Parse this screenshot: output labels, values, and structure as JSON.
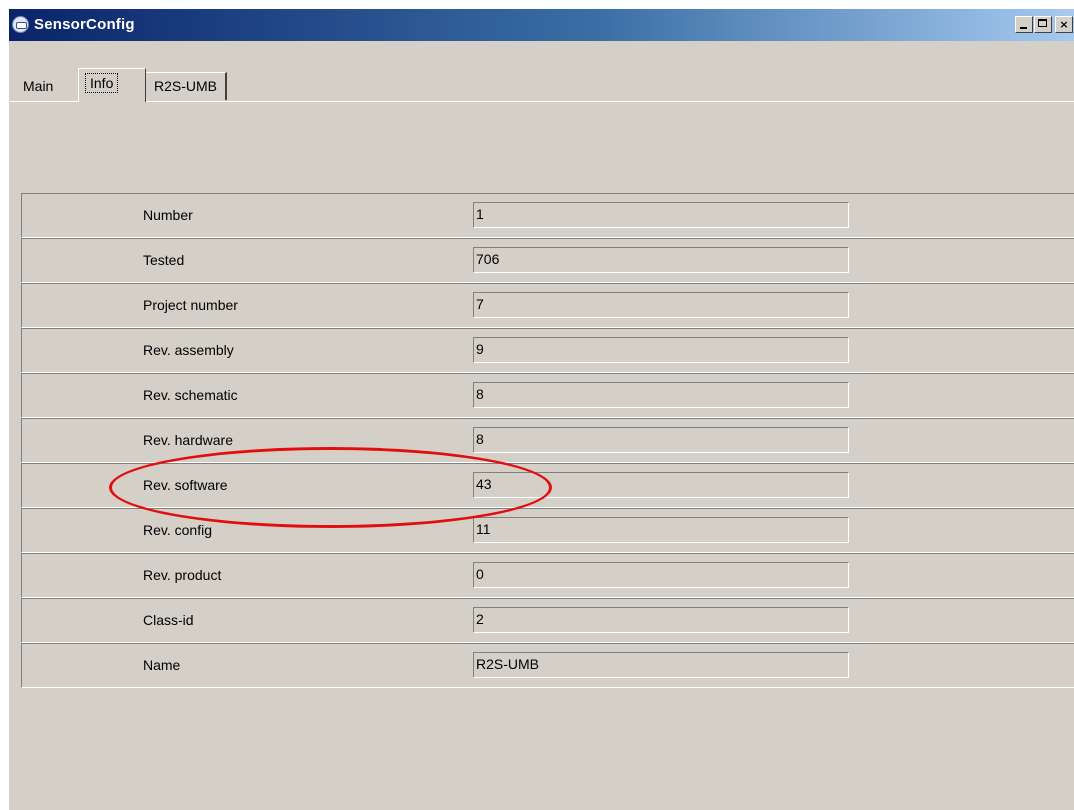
{
  "window": {
    "title": "SensorConfig"
  },
  "titlebar": {
    "min_label": "_",
    "max_label": "",
    "close_label": "×"
  },
  "tabs": [
    {
      "label": "Main"
    },
    {
      "label": "Info"
    },
    {
      "label": "R2S-UMB"
    }
  ],
  "active_tab": "Info",
  "info_rows": [
    {
      "label": "Number",
      "value": "1"
    },
    {
      "label": "Tested",
      "value": "706"
    },
    {
      "label": "Project number",
      "value": "7"
    },
    {
      "label": "Rev. assembly",
      "value": "9"
    },
    {
      "label": "Rev. schematic",
      "value": "8"
    },
    {
      "label": "Rev. hardware",
      "value": "8"
    },
    {
      "label": "Rev. software",
      "value": "43"
    },
    {
      "label": "Rev. config",
      "value": "11"
    },
    {
      "label": "Rev. product",
      "value": "0"
    },
    {
      "label": "Class-id",
      "value": "2"
    },
    {
      "label": "Name",
      "value": "R2S-UMB"
    }
  ],
  "annotation": {
    "highlighted_row": "Rev. software",
    "color": "#e20e0e"
  },
  "colors": {
    "face": "#d4d0c8",
    "title_start": "#0a246a",
    "title_end": "#a6caf0"
  }
}
